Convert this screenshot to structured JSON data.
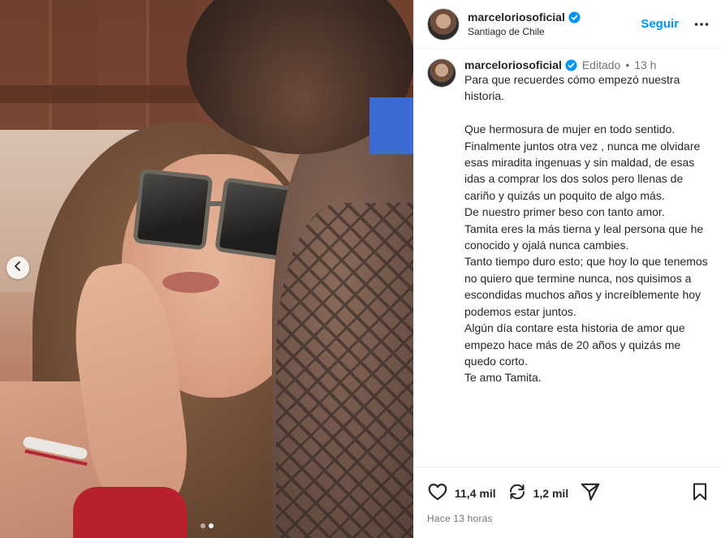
{
  "header": {
    "username": "marceloriosoficial",
    "location": "Santiago de Chile",
    "follow_label": "Seguir"
  },
  "caption": {
    "username": "marceloriosoficial",
    "edited_label": "Editado",
    "separator": "•",
    "time": "13 h",
    "text": "Para que recuerdes cómo empezó nuestra historia.\n\nQue hermosura de mujer en todo sentido. Finalmente juntos otra vez , nunca me olvidare esas miradita ingenuas y sin maldad, de esas idas a comprar los dos solos pero llenas de cariño y quizás un poquito de algo más.\nDe nuestro primer beso con tanto amor.\nTamita eres la más tierna y leal persona que he conocido y ojalá nunca cambies.\nTanto tiempo duro esto; que hoy lo que tenemos no quiero que termine nunca, nos quisimos a escondidas muchos años y increíblemente hoy podemos estar juntos.\nAlgún día contare esta historia de amor que empezo hace más de 20 años y quizás me quedo corto.\nTe amo Tamita."
  },
  "actions": {
    "likes": "11,4 mil",
    "reposts": "1,2 mil",
    "posted_ago": "Hace 13 horas"
  },
  "media": {
    "carousel_dots": 2,
    "active_index": 1
  },
  "icons": {
    "verified": "verified-badge-icon",
    "more": "more-options-icon",
    "prev": "chevron-left-icon",
    "like": "heart-icon",
    "repost": "repost-icon",
    "share": "send-icon",
    "save": "bookmark-icon"
  },
  "colors": {
    "accent": "#0095f6",
    "text": "#262626",
    "muted": "#737373"
  }
}
